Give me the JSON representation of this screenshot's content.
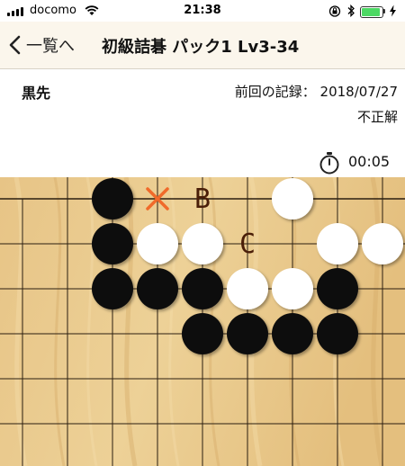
{
  "status_bar": {
    "carrier": "docomo",
    "time": "21:38",
    "battery_level": 0.92,
    "icons": [
      "signal-icon",
      "wifi-icon",
      "rotation-lock-icon",
      "bluetooth-icon",
      "battery-icon",
      "charging-icon"
    ]
  },
  "nav": {
    "back_label": "一覧へ",
    "title": "初級詰碁 パック1 Lv3-34"
  },
  "info": {
    "to_play": "黒先",
    "previous_record": "前回の記録： 2018/07/27",
    "result": "不正解",
    "timer": "00:05"
  },
  "board": {
    "colors": {
      "wood": "#e9c889",
      "line": "#2b1e10",
      "black": "#0a0a0a",
      "white": "#ffffff",
      "mark_x": "#f06a2a",
      "label": "#4a1e08"
    },
    "stones": [
      {
        "color": "black",
        "col": 2,
        "row": 0
      },
      {
        "color": "white",
        "col": 6,
        "row": 0
      },
      {
        "color": "black",
        "col": 2,
        "row": 1
      },
      {
        "color": "white",
        "col": 3,
        "row": 1
      },
      {
        "color": "white",
        "col": 4,
        "row": 1
      },
      {
        "color": "white",
        "col": 7,
        "row": 1
      },
      {
        "color": "white",
        "col": 8,
        "row": 1
      },
      {
        "color": "black",
        "col": 2,
        "row": 2
      },
      {
        "color": "black",
        "col": 3,
        "row": 2
      },
      {
        "color": "black",
        "col": 4,
        "row": 2
      },
      {
        "color": "white",
        "col": 5,
        "row": 2
      },
      {
        "color": "white",
        "col": 6,
        "row": 2
      },
      {
        "color": "black",
        "col": 7,
        "row": 2
      },
      {
        "color": "black",
        "col": 4,
        "row": 3
      },
      {
        "color": "black",
        "col": 5,
        "row": 3
      },
      {
        "color": "black",
        "col": 6,
        "row": 3
      },
      {
        "color": "black",
        "col": 7,
        "row": 3
      }
    ],
    "marks": [
      {
        "type": "x",
        "col": 3,
        "row": 0
      }
    ],
    "labels": [
      {
        "text": "B",
        "col": 4,
        "row": 0
      },
      {
        "text": "C",
        "col": 5,
        "row": 1
      }
    ]
  }
}
